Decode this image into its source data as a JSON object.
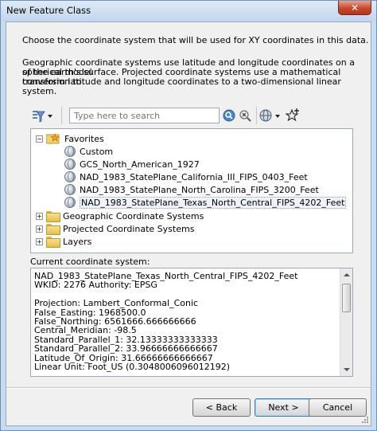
{
  "window": {
    "title": "New Feature Class",
    "close_glyph": "✕"
  },
  "intro": {
    "line1": "Choose the coordinate system that will be used for XY coordinates in this data.",
    "para2_line1": "Geographic coordinate systems use latitude and longitude coordinates on a spherical model",
    "para2_line2": "of the earth's surface. Projected coordinate systems use a mathematical conversion to",
    "para2_line3": "transform latitude and longitude coordinates to a two-dimensional linear system."
  },
  "toolbar": {
    "filter_icon": "filter-icon",
    "search_placeholder": "Type here to search",
    "search_icon": "magnifier-icon",
    "clear_search_icon": "search-clear-icon",
    "globe_menu_icon": "globe-icon",
    "add_favorite_icon": "star-add-icon"
  },
  "tree": {
    "favorites": {
      "label": "Favorites",
      "expander": "−",
      "items": [
        "Custom",
        "GCS_North_American_1927",
        "NAD_1983_StatePlane_California_III_FIPS_0403_Feet",
        "NAD_1983_StatePlane_North_Carolina_FIPS_3200_Feet",
        "NAD_1983_StatePlane_Texas_North_Central_FIPS_4202_Feet"
      ]
    },
    "folders": [
      {
        "label": "Geographic Coordinate Systems",
        "expander": "+"
      },
      {
        "label": "Projected Coordinate Systems",
        "expander": "+"
      },
      {
        "label": "Layers",
        "expander": "+"
      }
    ]
  },
  "current": {
    "label": "Current coordinate system:",
    "details": "NAD_1983_StatePlane_Texas_North_Central_FIPS_4202_Feet\nWKID: 2276 Authority: EPSG\n\nProjection: Lambert_Conformal_Conic\nFalse_Easting: 1968500.0\nFalse_Northing: 6561666.666666666\nCentral_Meridian: -98.5\nStandard_Parallel_1: 32.13333333333333\nStandard_Parallel_2: 33.96666666666667\nLatitude_Of_Origin: 31.66666666666667\nLinear Unit: Foot_US (0.3048006096012192)"
  },
  "buttons": {
    "back": "< Back",
    "next": "Next >",
    "cancel": "Cancel"
  },
  "colors": {
    "title_bar": "#c9dbef",
    "close_button": "#c7472b",
    "panel": "#f0f0f0"
  }
}
